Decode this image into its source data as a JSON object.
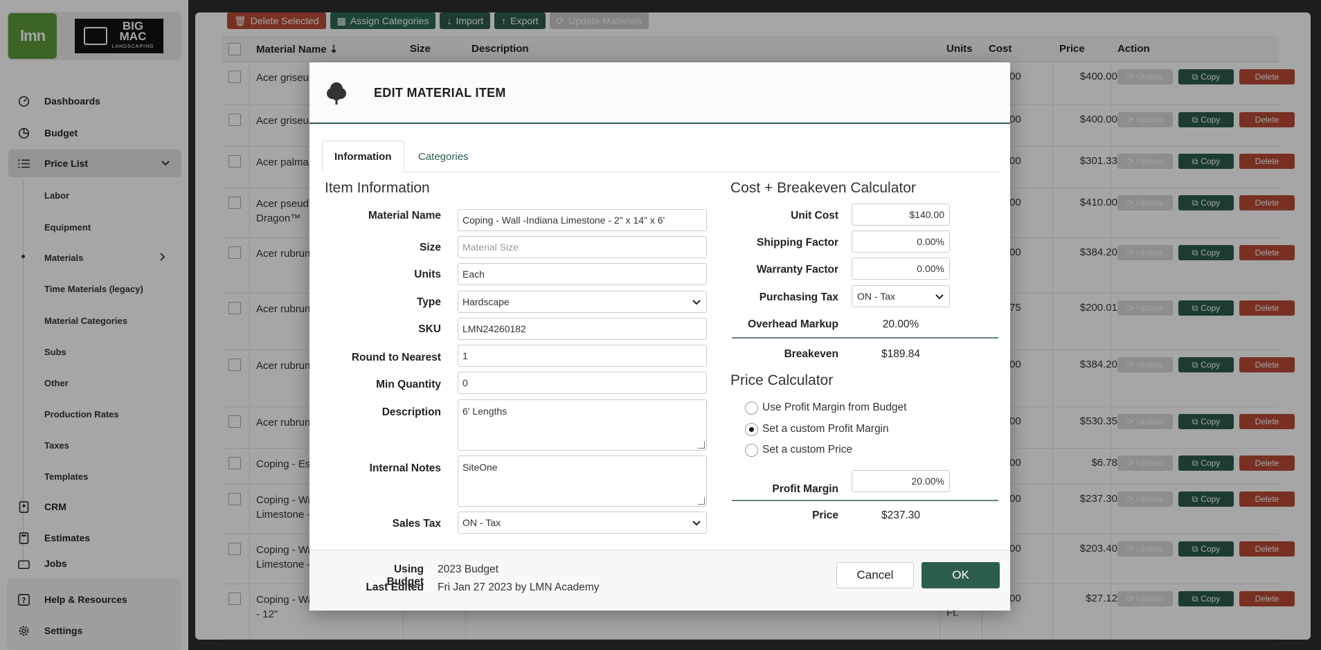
{
  "sidebar": {
    "logo_text": "lmn",
    "client_logo": {
      "line1": "BIG",
      "line2": "MAC",
      "line3": "LANDSCAPING"
    },
    "items": [
      {
        "label": "Dashboards",
        "icon": "dashboard-icon"
      },
      {
        "label": "Budget",
        "icon": "pie-chart-icon"
      },
      {
        "label": "Price List",
        "icon": "list-icon"
      },
      {
        "label": "CRM",
        "icon": "contact-card-icon"
      },
      {
        "label": "Estimates",
        "icon": "calculator-icon"
      },
      {
        "label": "Jobs",
        "icon": "briefcase-icon"
      }
    ],
    "sub_items": [
      {
        "label": "Labor"
      },
      {
        "label": "Equipment"
      },
      {
        "label": "Materials"
      },
      {
        "label": "Time Materials (legacy)"
      },
      {
        "label": "Material Categories"
      },
      {
        "label": "Subs"
      },
      {
        "label": "Other"
      },
      {
        "label": "Production Rates"
      },
      {
        "label": "Taxes"
      },
      {
        "label": "Templates"
      }
    ],
    "bottom": [
      {
        "label": "Help & Resources",
        "icon": "help-icon"
      },
      {
        "label": "Settings",
        "icon": "gear-icon"
      }
    ]
  },
  "toolbar": {
    "delete_selected": "Delete Selected",
    "assign_categories": "Assign Categories",
    "import": "Import",
    "export": "Export",
    "update_materials": "Update Materials"
  },
  "table": {
    "headers": {
      "material_name": "Material Name",
      "size": "Size",
      "description": "Description",
      "units": "Units",
      "cost": "Cost",
      "price": "Price",
      "action": "Action"
    },
    "actions": {
      "update": "Update",
      "copy": "Copy",
      "delete": "Delete"
    },
    "rows": [
      {
        "name": "Acer griseu",
        "cost_tail": "00",
        "price": "$400.00"
      },
      {
        "name": "Acer griseu",
        "cost_tail": "00",
        "price": "$400.00"
      },
      {
        "name": "Acer palma",
        "cost_tail": "00",
        "price": "$301.33"
      },
      {
        "name": "Acer pseud",
        "name2": "Dragon™",
        "cost_tail": "00",
        "price": "$410.00"
      },
      {
        "name": "Acer rubrun",
        "cost_tail": "00",
        "price": "$384.20"
      },
      {
        "name": "Acer rubrun",
        "cost_tail": "75",
        "price": "$200.01"
      },
      {
        "name": "Acer rubrun",
        "cost_tail": "00",
        "price": "$384.20"
      },
      {
        "name": "Acer rubrun",
        "cost_tail": "00",
        "price": "$530.35"
      },
      {
        "name": "Coping - Est",
        "cost_tail": "00",
        "price": "$6.78"
      },
      {
        "name": "Coping - Wa",
        "name2": "Limestone -",
        "cost_tail": "00",
        "price": "$237.30"
      },
      {
        "name": "Coping - Wa",
        "name2": "Limestone -",
        "cost_tail": "00",
        "price": "$203.40"
      },
      {
        "name": "Coping - Wa",
        "name2": "- 12\"",
        "units2": "Ft.",
        "cost_tail": "00",
        "price": "$27.12"
      }
    ]
  },
  "modal": {
    "title": "EDIT MATERIAL ITEM",
    "tabs": {
      "information": "Information",
      "categories": "Categories"
    },
    "item_info": {
      "section_title": "Item Information",
      "material_name_label": "Material Name",
      "material_name_value": "Coping - Wall  -Indiana Limestone - 2\" x 14\" x 6'",
      "size_label": "Size",
      "size_placeholder": "Material Size",
      "units_label": "Units",
      "units_value": "Each",
      "type_label": "Type",
      "type_value": "Hardscape",
      "sku_label": "SKU",
      "sku_value": "LMN24260182",
      "round_label": "Round to Nearest",
      "round_value": "1",
      "min_qty_label": "Min Quantity",
      "min_qty_value": "0",
      "description_label": "Description",
      "description_value": "6' Lengths",
      "notes_label": "Internal Notes",
      "notes_value": "SiteOne",
      "sales_tax_label": "Sales Tax",
      "sales_tax_value": "ON - Tax"
    },
    "cost_calc": {
      "section_title": "Cost + Breakeven Calculator",
      "unit_cost_label": "Unit Cost",
      "unit_cost_value": "$140.00",
      "shipping_label": "Shipping Factor",
      "shipping_value": "0.00%",
      "warranty_label": "Warranty Factor",
      "warranty_value": "0.00%",
      "purchasing_tax_label": "Purchasing Tax",
      "purchasing_tax_value": "ON - Tax",
      "overhead_label": "Overhead Markup",
      "overhead_value": "20.00%",
      "breakeven_label": "Breakeven",
      "breakeven_value": "$189.84"
    },
    "price_calc": {
      "section_title": "Price Calculator",
      "opt_budget": "Use Profit Margin from Budget",
      "opt_custom_margin": "Set a custom Profit Margin",
      "opt_custom_price": "Set a custom Price",
      "selected": "custom_margin",
      "margin_label": "Profit Margin",
      "margin_value": "20.00%",
      "price_label": "Price",
      "price_value": "$237.30"
    },
    "footer": {
      "budget_label": "Using Budget",
      "budget_value": "2023 Budget",
      "edited_label": "Last Edited",
      "edited_value": "Fri Jan 27 2023 by LMN Academy",
      "cancel": "Cancel",
      "ok": "OK"
    }
  },
  "colors": {
    "brand_green": "#2c5d4f",
    "danger": "#b84a35",
    "lmn_green": "#5b9a3c"
  }
}
